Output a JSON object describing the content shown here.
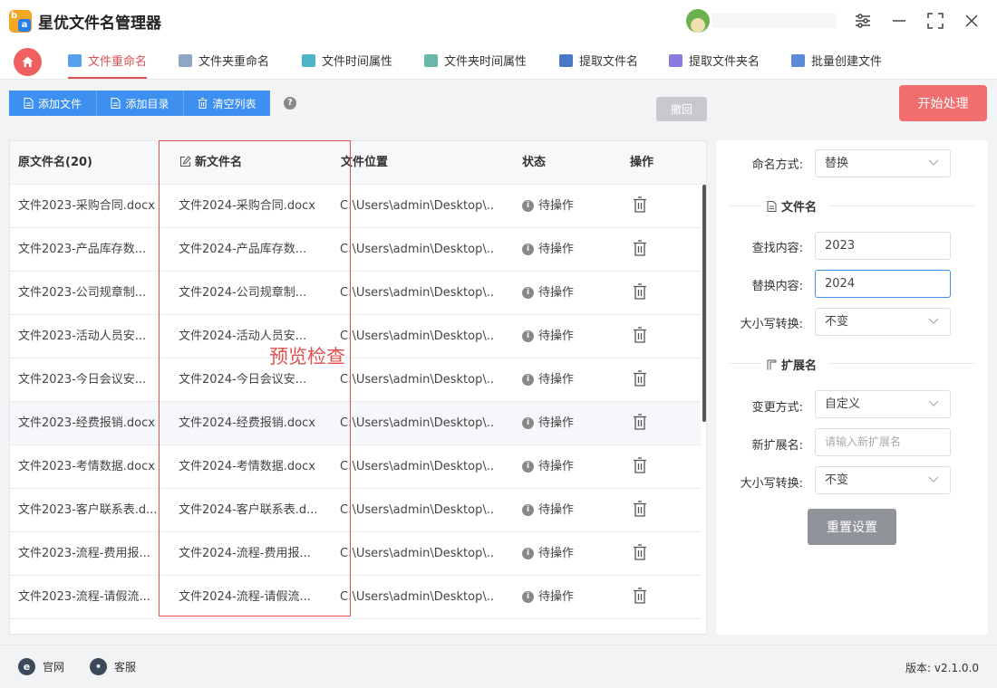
{
  "app": {
    "title": "星优文件名管理器",
    "logo_letters": [
      "b",
      "a"
    ]
  },
  "window_controls": [
    "settings-icon",
    "minimize-icon",
    "maximize-icon",
    "close-icon"
  ],
  "tabs": [
    {
      "label": "文件重命名",
      "icon": "file-rename-icon",
      "color": "#5aa0f0",
      "active": true
    },
    {
      "label": "文件夹重命名",
      "icon": "folder-rename-icon",
      "color": "#8fa6c4",
      "active": false
    },
    {
      "label": "文件时间属性",
      "icon": "file-time-icon",
      "color": "#4fb3c8",
      "active": false
    },
    {
      "label": "文件夹时间属性",
      "icon": "folder-time-icon",
      "color": "#6ab8a8",
      "active": false
    },
    {
      "label": "提取文件名",
      "icon": "extract-filename-icon",
      "color": "#4a78c8",
      "active": false
    },
    {
      "label": "提取文件夹名",
      "icon": "extract-foldername-icon",
      "color": "#8a7ae0",
      "active": false
    },
    {
      "label": "批量创建文件",
      "icon": "batch-create-icon",
      "color": "#5a8ad8",
      "active": false
    }
  ],
  "toolbar": {
    "add_file": "添加文件",
    "add_dir": "添加目录",
    "clear_list": "清空列表",
    "help": "?",
    "undo": "撤回",
    "start": "开始处理"
  },
  "table": {
    "headers": {
      "original": "原文件名(20)",
      "new": "新文件名",
      "location": "文件位置",
      "status": "状态",
      "action": "操作"
    },
    "rows": [
      {
        "original": "文件2023-采购合同.docx",
        "new": "文件2024-采购合同.docx",
        "location": "C:\\Users\\admin\\Desktop\\...",
        "status": "待操作"
      },
      {
        "original": "文件2023-产品库存数...",
        "new": "文件2024-产品库存数...",
        "location": "C:\\Users\\admin\\Desktop\\...",
        "status": "待操作"
      },
      {
        "original": "文件2023-公司规章制...",
        "new": "文件2024-公司规章制...",
        "location": "C:\\Users\\admin\\Desktop\\...",
        "status": "待操作"
      },
      {
        "original": "文件2023-活动人员安...",
        "new": "文件2024-活动人员安...",
        "location": "C:\\Users\\admin\\Desktop\\...",
        "status": "待操作"
      },
      {
        "original": "文件2023-今日会议安...",
        "new": "文件2024-今日会议安...",
        "location": "C:\\Users\\admin\\Desktop\\...",
        "status": "待操作"
      },
      {
        "original": "文件2023-经费报销.docx",
        "new": "文件2024-经费报销.docx",
        "location": "C:\\Users\\admin\\Desktop\\...",
        "status": "待操作"
      },
      {
        "original": "文件2023-考情数据.docx",
        "new": "文件2024-考情数据.docx",
        "location": "C:\\Users\\admin\\Desktop\\...",
        "status": "待操作"
      },
      {
        "original": "文件2023-客户联系表.d...",
        "new": "文件2024-客户联系表.d...",
        "location": "C:\\Users\\admin\\Desktop\\...",
        "status": "待操作"
      },
      {
        "original": "文件2023-流程-费用报...",
        "new": "文件2024-流程-费用报...",
        "location": "C:\\Users\\admin\\Desktop\\...",
        "status": "待操作"
      },
      {
        "original": "文件2023-流程-请假流...",
        "new": "文件2024-流程-请假流...",
        "location": "C:\\Users\\admin\\Desktop\\...",
        "status": "待操作"
      }
    ],
    "annotation": "预览检查"
  },
  "settings": {
    "naming_method_label": "命名方式:",
    "naming_method_value": "替换",
    "filename_section": "文件名",
    "find_label": "查找内容:",
    "find_value": "2023",
    "replace_label": "替换内容:",
    "replace_value": "2024",
    "case_label": "大小写转换:",
    "case_value": "不变",
    "ext_section": "扩展名",
    "change_method_label": "变更方式:",
    "change_method_value": "自定义",
    "new_ext_label": "新扩展名:",
    "new_ext_placeholder": "请输入新扩展名",
    "ext_case_label": "大小写转换:",
    "ext_case_value": "不变",
    "reset": "重置设置"
  },
  "footer": {
    "website": "官网",
    "support": "客服",
    "version": "版本: v2.1.0.0"
  },
  "colors": {
    "accent": "#e05050",
    "primary": "#3d8ff0",
    "start": "#f26d6d"
  }
}
